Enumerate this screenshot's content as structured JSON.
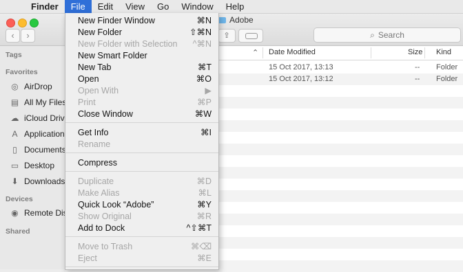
{
  "menubar": {
    "apple": "",
    "items": [
      "Finder",
      "File",
      "Edit",
      "View",
      "Go",
      "Window",
      "Help"
    ],
    "active": "File"
  },
  "window": {
    "title": "Adobe",
    "search_placeholder": "Search"
  },
  "sidebar": {
    "tags_header": "Tags",
    "favorites_header": "Favorites",
    "favorites": [
      {
        "label": "AirDrop",
        "icon": "airdrop-icon"
      },
      {
        "label": "All My Files",
        "icon": "files-icon"
      },
      {
        "label": "iCloud Drive",
        "icon": "cloud-icon"
      },
      {
        "label": "Applications",
        "icon": "applications-icon"
      },
      {
        "label": "Documents",
        "icon": "document-icon"
      },
      {
        "label": "Desktop",
        "icon": "desktop-icon"
      },
      {
        "label": "Downloads",
        "icon": "download-icon"
      }
    ],
    "devices_header": "Devices",
    "devices": [
      {
        "label": "Remote Disc",
        "icon": "disc-icon"
      }
    ],
    "shared_header": "Shared"
  },
  "list": {
    "columns": {
      "date": "Date Modified",
      "size": "Size",
      "kind": "Kind"
    },
    "rows": [
      {
        "date": "15 Oct 2017, 13:13",
        "size": "--",
        "kind": "Folder"
      },
      {
        "date": "15 Oct 2017, 13:12",
        "size": "--",
        "kind": "Folder"
      }
    ]
  },
  "file_menu": {
    "items": [
      {
        "label": "New Finder Window",
        "shortcut": "⌘N",
        "enabled": true
      },
      {
        "label": "New Folder",
        "shortcut": "⇧⌘N",
        "enabled": true
      },
      {
        "label": "New Folder with Selection",
        "shortcut": "^⌘N",
        "enabled": false
      },
      {
        "label": "New Smart Folder",
        "shortcut": "",
        "enabled": true
      },
      {
        "label": "New Tab",
        "shortcut": "⌘T",
        "enabled": true
      },
      {
        "label": "Open",
        "shortcut": "⌘O",
        "enabled": true
      },
      {
        "label": "Open With",
        "shortcut": "▶",
        "enabled": false
      },
      {
        "label": "Print",
        "shortcut": "⌘P",
        "enabled": false
      },
      {
        "label": "Close Window",
        "shortcut": "⌘W",
        "enabled": true
      },
      {
        "label": "Get Info",
        "shortcut": "⌘I",
        "enabled": true
      },
      {
        "label": "Rename",
        "shortcut": "",
        "enabled": false
      },
      {
        "label": "Compress",
        "shortcut": "",
        "enabled": true
      },
      {
        "label": "Duplicate",
        "shortcut": "⌘D",
        "enabled": false
      },
      {
        "label": "Make Alias",
        "shortcut": "⌘L",
        "enabled": false
      },
      {
        "label": "Quick Look “Adobe”",
        "shortcut": "⌘Y",
        "enabled": true
      },
      {
        "label": "Show Original",
        "shortcut": "⌘R",
        "enabled": false
      },
      {
        "label": "Add to Dock",
        "shortcut": "^⇧⌘T",
        "enabled": true
      },
      {
        "label": "Move to Trash",
        "shortcut": "⌘⌫",
        "enabled": false
      },
      {
        "label": "Eject",
        "shortcut": "⌘E",
        "enabled": false
      }
    ]
  }
}
